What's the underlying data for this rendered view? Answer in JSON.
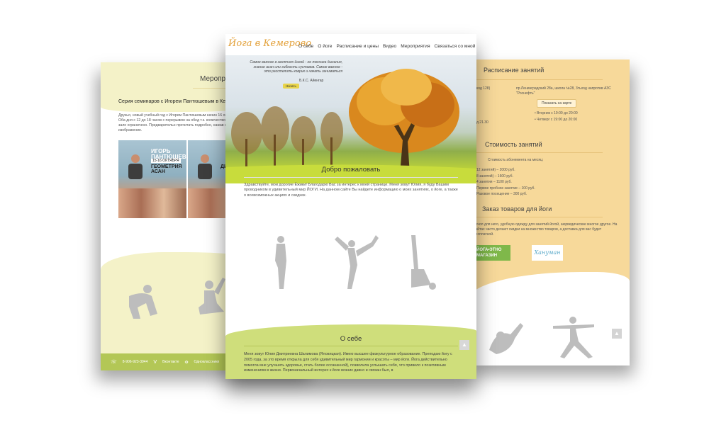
{
  "left_page": {
    "title": "Меропри",
    "heading": "Серия семинаров с Игорем Пантюшевым в Кемер",
    "paragraph": "Друзья, новый учебный год с Игорем Пантюшевым начин 16 октября. Оба дня с 12 до 18 часов с перерывом на обед т.к. количество мест в зале ограничено. Предварительн прочитать подробно, нажав на изображение.",
    "poster": {
      "name": "ИГОРЬ ПАНТЮШЕВ",
      "dates": "15-16 ОКТЯБРЯ",
      "subject": "ГЕОМЕТРИЯ АСАН",
      "subject_partial": "ДИ"
    },
    "footer": {
      "phone": "8-906-923-3944",
      "vk": "Вконтакте",
      "ok": "Одноклассники"
    }
  },
  "center_page": {
    "logo": "Йога в Кемерово",
    "menu": [
      "О себе",
      "О йоге",
      "Расписание и цены",
      "Видео",
      "Мероприятия",
      "Связаться со мной"
    ],
    "hero": {
      "quote": "Самое важное в занятиях йогой - не техника дыхания, знание асан или гибкость суставов. Самое важное - это расстелить коврик и начать заниматься",
      "author": "Б.К.С. Айенгар",
      "start_button": "Начать"
    },
    "welcome_title": "Добро пожаловать",
    "intro": "Здравствуйте, мои дорогие Ёжики! Благодарю Вас за интерес к моей странице. Меня зовут Юлия, я буду Вашим проводником в удивительный мир ЙОГИ. На данном сайте Вы найдете информацию о моих занятиях, о йоге, а также о всевозможных акциях и скидках.",
    "about_title": "О себе",
    "about_text": "Меня зовут Юлия Дмитриевна Шалимова (Яловицкая). Имею высшее физкультурное образование. Преподаю йогу с 2005 года, за это время открыла для себя удивительный мир гармонии и красоты – мир йоги. Йога действительно помогла мне улучшить здоровье, стать более осознанной), позволила услышать себя, что привело к позитивным изменениям в жизни. Первоначальный интерес к йоге возник давно и связан был, в",
    "up_arrow": "▲"
  },
  "right_page": {
    "title": "Расписание занятий",
    "address_left": "код 128)",
    "address": "пр.Ленинградский 28а, школа №28, 3тьход напротив АЗС \"Роснефть\"",
    "map_button": "Показать на карте",
    "schedule": [
      "Вторник с 19:00 до 20:00",
      "Четверг с 19:00 до 20:00"
    ],
    "time_partial": "д 21.30",
    "cost_title": "Стоимость занятий",
    "cost_head": "Стоимость абонемента на месяц:",
    "prices": [
      "12 занятий) – 2000 руб.",
      "8 занятий) – 1600 руб.",
      "4 занятия – 1100 руб.",
      "Первое пробное занятие – 100 руб.",
      "Разовое посещение – 300 руб."
    ],
    "shop_title": "Заказ товаров для йоги",
    "shop_text": "нечол для него, удобную одежду для занятий йогой, аюрведические многое другое. На сайтах часто делают скидки на множество товаров, а доставка для вас будет бесплатной.",
    "logo_shop": "ЙОГА•ЭТНО МАГАЗИН",
    "logo_brand": "Хануман",
    "up_arrow": "▲"
  },
  "colors": {
    "accent_green": "#b3c756",
    "soft_green": "#cfde7b",
    "cream": "#f4f2c8",
    "peach": "#f7d99a",
    "logo_orange": "#e3a13a"
  }
}
